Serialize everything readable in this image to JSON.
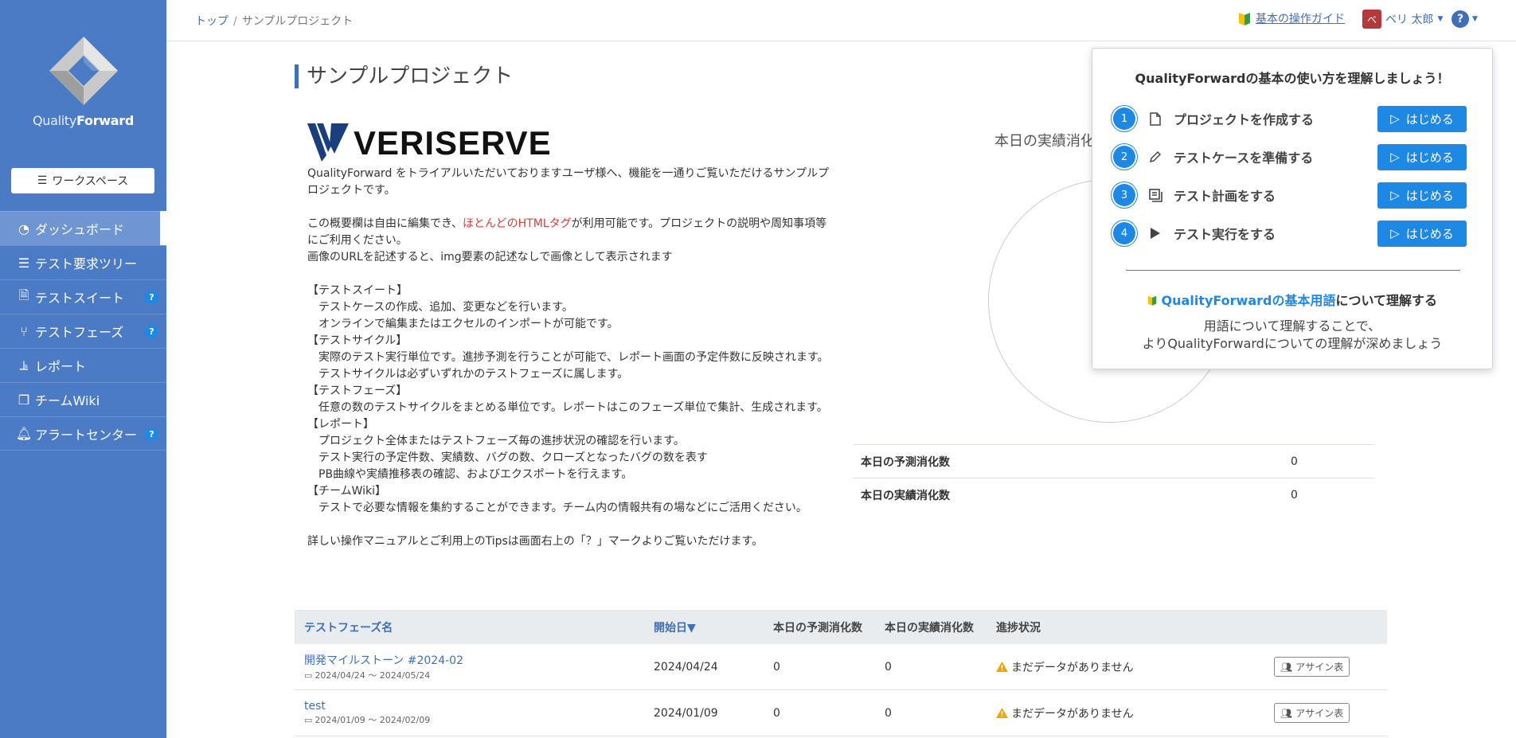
{
  "sidebar": {
    "logo": {
      "text_light": "Quality",
      "text_bold": "Forward"
    },
    "workspace_button": "ワークスペース",
    "items": [
      {
        "label": "ダッシュボード",
        "icon": "dashboard-icon",
        "active": true,
        "help": false
      },
      {
        "label": "テスト要求ツリー",
        "icon": "list-icon",
        "active": false,
        "help": false
      },
      {
        "label": "テストスイート",
        "icon": "document-icon",
        "active": false,
        "help": true
      },
      {
        "label": "テストフェーズ",
        "icon": "flow-icon",
        "active": false,
        "help": true
      },
      {
        "label": "レポート",
        "icon": "chart-icon",
        "active": false,
        "help": false
      },
      {
        "label": "チームWiki",
        "icon": "wiki-icon",
        "active": false,
        "help": false
      },
      {
        "label": "アラートセンター",
        "icon": "bell-icon",
        "active": false,
        "help": true
      }
    ],
    "help_mark": "?"
  },
  "header": {
    "breadcrumb": {
      "home": "トップ",
      "separator": "/",
      "current": "サンプルプロジェクト"
    },
    "guide_link": "基本の操作ガイド",
    "user": {
      "avatar_letter": "ベ",
      "name": "ベリ 太郎"
    },
    "help": "?"
  },
  "main": {
    "title": "サンプルプロジェクト",
    "logo_text": "VERISERVE",
    "description": {
      "intro": "QualityForward をトライアルいただいておりますユーザ様へ、機能を一通りご覧いただけるサンプルプロジェクトです。",
      "edit_pre": "この概要欄は自由に編集でき、",
      "edit_red": "ほとんどのHTMLタグ",
      "edit_post": "が利用可能です。プロジェクトの説明や周知事項等にご利用ください。",
      "image_note": "画像のURLを記述すると、img要素の記述なしで画像として表示されます",
      "suite_head": "【テストスイート】",
      "suite_1": "　テストケースの作成、追加、変更などを行います。",
      "suite_2": "　オンラインで編集またはエクセルのインポートが可能です。",
      "cycle_head": "【テストサイクル】",
      "cycle_1": "　実際のテスト実行単位です。進捗予測を行うことが可能で、レポート画面の予定件数に反映されます。",
      "cycle_2": "　テストサイクルは必ずいずれかのテストフェーズに属します。",
      "phase_head": "【テストフェーズ】",
      "phase_1": "　任意の数のテストサイクルをまとめる単位です。レポートはこのフェーズ単位で集計、生成されます。",
      "report_head": "【レポート】",
      "report_1": "　プロジェクト全体またはテストフェーズ毎の進捗状況の確認を行います。",
      "report_2": "　テスト実行の予定件数、実績数、バグの数、クローズとなったバグの数を表す",
      "report_3": "　PB曲線や実績推移表の確認、およびエクスポートを行えます。",
      "wiki_head": "【チームWiki】",
      "wiki_1": "　テストで必要な情報を集約することができます。チーム内の情報共有の場などにご活用ください。",
      "footer": "詳しい操作マニュアルとご利用上のTipsは画面右上の「？」マークよりご覧いただけます。"
    },
    "today_label": "本日の実績消化",
    "stats": [
      {
        "label": "本日の予測消化数",
        "value": "0"
      },
      {
        "label": "本日の実績消化数",
        "value": "0"
      }
    ]
  },
  "table": {
    "headers": {
      "name": "テストフェーズ名",
      "start": "開始日▼",
      "forecast": "本日の予測消化数",
      "actual": "本日の実績消化数",
      "progress": "進捗状況"
    },
    "rows": [
      {
        "name": "開発マイルストーン #2024-02",
        "range": "2024/04/24 〜 2024/05/24",
        "start": "2024/04/24",
        "forecast": "0",
        "actual": "0",
        "status": "まだデータがありません",
        "assign": "アサイン表"
      },
      {
        "name": "test",
        "range": "2024/01/09 〜 2024/02/09",
        "start": "2024/01/09",
        "forecast": "0",
        "actual": "0",
        "status": "まだデータがありません",
        "assign": "アサイン表"
      }
    ]
  },
  "guide": {
    "title": "QualityForwardの基本の使い方を理解しましょう！",
    "steps": [
      {
        "num": "1",
        "label": "プロジェクトを作成する",
        "icon": "file-icon",
        "button": "はじめる"
      },
      {
        "num": "2",
        "label": "テストケースを準備する",
        "icon": "pencil-icon",
        "button": "はじめる"
      },
      {
        "num": "3",
        "label": "テスト計画をする",
        "icon": "plan-icon",
        "button": "はじめる"
      },
      {
        "num": "4",
        "label": "テスト実行をする",
        "icon": "play-icon",
        "button": "はじめる"
      }
    ],
    "terms_link": "QualityForwardの基本用語",
    "terms_suffix": "について理解する",
    "terms_desc_1": "用語について理解することで、",
    "terms_desc_2": "よりQualityForwardについての理解が深めましょう"
  },
  "colors": {
    "sidebar": "#4b7bc4",
    "accent": "#1e88e5",
    "link": "#3f6fb7",
    "warning": "#f0a500"
  }
}
